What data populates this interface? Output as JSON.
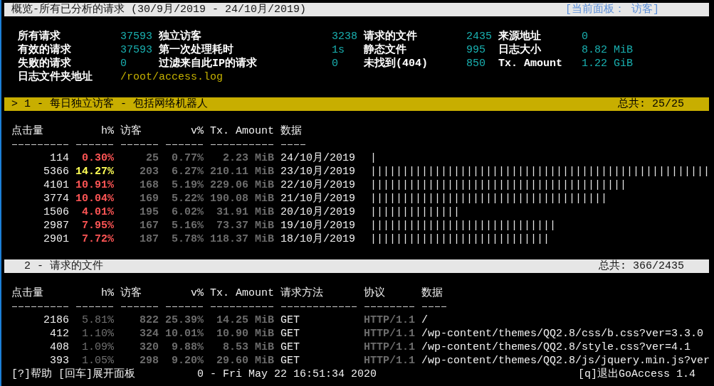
{
  "title_bar": {
    "title": "概览-所有已分析的请求 (30/9月/2019 - 24/10月/2019)",
    "active_panel": "[当前面板： 访客]"
  },
  "overview": {
    "rows": [
      {
        "metrics": [
          {
            "label": "所有请求",
            "value": "37593"
          },
          {
            "label": "独立访客",
            "value": "3238"
          },
          {
            "label": "请求的文件",
            "value": "2435"
          },
          {
            "label": "来源地址",
            "value": "0"
          }
        ]
      },
      {
        "metrics": [
          {
            "label": "有效的请求",
            "value": "37593"
          },
          {
            "label": "第一次处理耗时",
            "value": "1s"
          },
          {
            "label": "静态文件",
            "value": "995"
          },
          {
            "label": "日志大小",
            "value": "8.82 MiB"
          }
        ]
      },
      {
        "metrics": [
          {
            "label": "失败的请求",
            "value": "0"
          },
          {
            "label": "过滤来自此IP的请求",
            "value": "0"
          },
          {
            "label": "未找到(404)",
            "value": "850"
          },
          {
            "label": "Tx. Amount",
            "value": "1.22 GiB"
          }
        ]
      }
    ],
    "log_file": {
      "label": "日志文件夹地址",
      "value": "/root/access.log"
    }
  },
  "panels": [
    {
      "kind": "visitors",
      "selected": true,
      "marker": ">",
      "title": "1 - 每日独立访客 - 包括网络机器人",
      "total": "总共: 25/25",
      "columns": [
        "点击量",
        "h%",
        "访客",
        "v%",
        "Tx. Amount",
        "数据"
      ],
      "rows": [
        {
          "cells": [
            "114",
            "0.30%",
            "25",
            "0.77%",
            "2.23 MiB",
            "24/10月/2019"
          ],
          "color": "#ff5555",
          "bar": "|"
        },
        {
          "cells": [
            "5366",
            "14.27%",
            "203",
            "6.27%",
            "210.11 MiB",
            "23/10月/2019"
          ],
          "color": "#ffff55",
          "bar": "|||||||||||||||||||||||||||||||||||||||||||||||||||||"
        },
        {
          "cells": [
            "4101",
            "10.91%",
            "168",
            "5.19%",
            "229.06 MiB",
            "22/10月/2019"
          ],
          "color": "#ff5555",
          "bar": "||||||||||||||||||||||||||||||||||||||||"
        },
        {
          "cells": [
            "3774",
            "10.04%",
            "169",
            "5.22%",
            "190.08 MiB",
            "21/10月/2019"
          ],
          "color": "#ff5555",
          "bar": "|||||||||||||||||||||||||||||||||||||"
        },
        {
          "cells": [
            "1506",
            "4.01%",
            "195",
            "6.02%",
            "31.91 MiB",
            "20/10月/2019"
          ],
          "color": "#ff5555",
          "bar": "||||||||||||||"
        },
        {
          "cells": [
            "2987",
            "7.95%",
            "167",
            "5.16%",
            "73.37 MiB",
            "19/10月/2019"
          ],
          "color": "#ff5555",
          "bar": "|||||||||||||||||||||||||||||"
        },
        {
          "cells": [
            "2901",
            "7.72%",
            "187",
            "5.78%",
            "118.37 MiB",
            "18/10月/2019"
          ],
          "color": "#ff5555",
          "bar": "||||||||||||||||||||||||||||"
        }
      ]
    },
    {
      "kind": "requests",
      "selected": false,
      "title": "2 - 请求的文件",
      "total": "总共: 366/2435",
      "columns": [
        "点击量",
        "h%",
        "访客",
        "v%",
        "Tx. Amount",
        "请求方法",
        "协议",
        "数据"
      ],
      "rows": [
        {
          "cells": [
            "2186",
            "5.81%",
            "822",
            "25.39%",
            "14.25 MiB",
            "GET",
            "HTTP/1.1",
            "/"
          ]
        },
        {
          "cells": [
            "412",
            "1.10%",
            "324",
            "10.01%",
            "10.90 MiB",
            "GET",
            "HTTP/1.1",
            "/wp-content/themes/QQ2.8/css/b.css?ver=3.3.0"
          ]
        },
        {
          "cells": [
            "408",
            "1.09%",
            "320",
            "9.88%",
            "8.53 MiB",
            "GET",
            "HTTP/1.1",
            "/wp-content/themes/QQ2.8/style.css?ver=4.1"
          ]
        },
        {
          "cells": [
            "393",
            "1.05%",
            "298",
            "9.20%",
            "29.60 MiB",
            "GET",
            "HTTP/1.1",
            "/wp-content/themes/QQ2.8/js/jquery.min.js?ver"
          ]
        }
      ]
    }
  ],
  "footer": {
    "hints": [
      "[?]帮助",
      "[回车]展开面板"
    ],
    "status": "0 - Fri May 22 16:51:34 2020",
    "quit": "[q]退出GoAccess 1.4"
  }
}
